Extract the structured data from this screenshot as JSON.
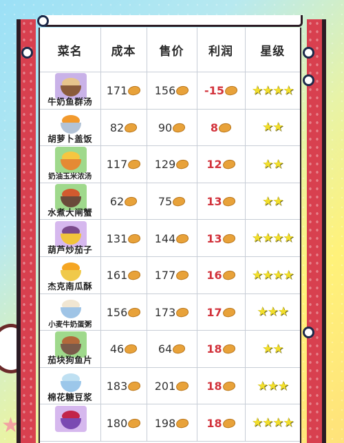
{
  "headers": [
    "菜名",
    "成本",
    "售价",
    "利润",
    "星级"
  ],
  "rows": [
    {
      "name": "牛奶鱼群汤",
      "cost": "171",
      "price": "156",
      "profit": "-15",
      "stars": "★★★★",
      "img_bg": "#c9b2e8",
      "food": "#e7c48c",
      "bowl": "#8a5b3a",
      "small": false
    },
    {
      "name": "胡萝卜盖饭",
      "cost": "82",
      "price": "90",
      "profit": "8",
      "stars": "★★",
      "img_bg": "#ffffff",
      "food": "#f29a2e",
      "bowl": "#b3c3d6",
      "small": false
    },
    {
      "name": "奶油玉米浓汤",
      "cost": "117",
      "price": "129",
      "profit": "12",
      "stars": "★★",
      "img_bg": "#9fd98c",
      "food": "#f6c640",
      "bowl": "#e58a34",
      "small": true
    },
    {
      "name": "水煮大闸蟹",
      "cost": "62",
      "price": "75",
      "profit": "13",
      "stars": "★★",
      "img_bg": "#9fd98c",
      "food": "#d25a2e",
      "bowl": "#6a4a3a",
      "small": false
    },
    {
      "name": "葫芦炒茄子",
      "cost": "131",
      "price": "144",
      "profit": "13",
      "stars": "★★★★",
      "img_bg": "#d6b8ee",
      "food": "#7a4a8a",
      "bowl": "#f1c43a",
      "small": false
    },
    {
      "name": "杰克南瓜酥",
      "cost": "161",
      "price": "177",
      "profit": "16",
      "stars": "★★★★",
      "img_bg": "#ffffff",
      "food": "#f5a623",
      "bowl": "#f0c94a",
      "small": false
    },
    {
      "name": "小麦牛奶蛋粥",
      "cost": "156",
      "price": "173",
      "profit": "17",
      "stars": "★★★",
      "img_bg": "#ffffff",
      "food": "#f1e6d2",
      "bowl": "#9fc4e6",
      "small": true
    },
    {
      "name": "茄块狗鱼片",
      "cost": "46",
      "price": "64",
      "profit": "18",
      "stars": "★★",
      "img_bg": "#9fd98c",
      "food": "#b2683a",
      "bowl": "#7a5a4a",
      "small": false
    },
    {
      "name": "棉花糖豆浆",
      "cost": "183",
      "price": "201",
      "profit": "18",
      "stars": "★★★",
      "img_bg": "#ffffff",
      "food": "#bfe0f2",
      "bowl": "#9cc7ea",
      "small": false
    },
    {
      "name": "",
      "cost": "180",
      "price": "198",
      "profit": "18",
      "stars": "★★★★",
      "img_bg": "#d6b8ee",
      "food": "#c2254a",
      "bowl": "#7a4ab2",
      "small": false
    }
  ],
  "colors": {
    "loss": "#d2333c",
    "profit": "#d2333c",
    "star": "#f3df2a",
    "band": "#d8404f"
  },
  "icons": {
    "currency": "bread-coin-icon",
    "rating": "star-icon"
  }
}
